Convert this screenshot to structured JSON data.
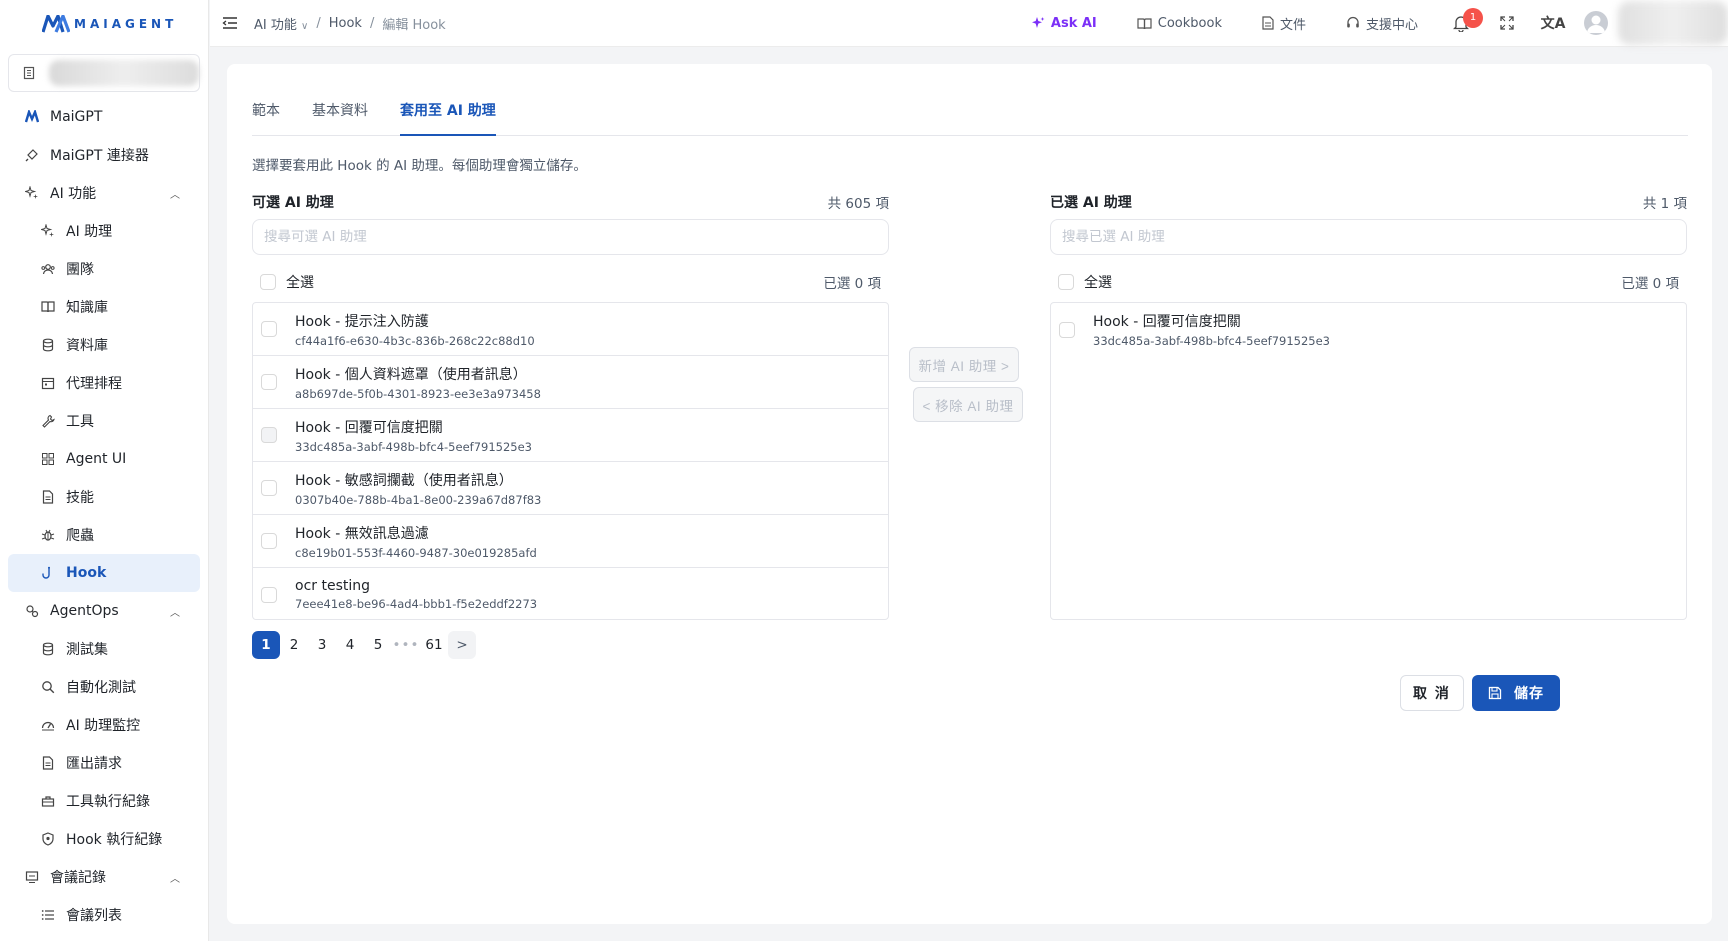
{
  "app": {
    "logo_text": "MAIAGENT"
  },
  "sidebar": {
    "items": [
      {
        "label": "MaiGPT",
        "icon": "maigpt-logo-icon",
        "type": "top"
      },
      {
        "label": "MaiGPT 連接器",
        "icon": "plug-icon",
        "type": "top"
      },
      {
        "label": "AI 功能",
        "icon": "sparkle-icon",
        "type": "group"
      },
      {
        "label": "AI 助理",
        "icon": "sparkle-icon",
        "type": "sub"
      },
      {
        "label": "團隊",
        "icon": "team-icon",
        "type": "sub"
      },
      {
        "label": "知識庫",
        "icon": "book-icon",
        "type": "sub"
      },
      {
        "label": "資料庫",
        "icon": "database-icon",
        "type": "sub"
      },
      {
        "label": "代理排程",
        "icon": "calendar-icon",
        "type": "sub"
      },
      {
        "label": "工具",
        "icon": "wrench-icon",
        "type": "sub"
      },
      {
        "label": "Agent UI",
        "icon": "grid-icon",
        "type": "sub"
      },
      {
        "label": "技能",
        "icon": "file-icon",
        "type": "sub"
      },
      {
        "label": "爬蟲",
        "icon": "bug-icon",
        "type": "sub"
      },
      {
        "label": "Hook",
        "icon": "hook-icon",
        "type": "sub-active"
      },
      {
        "label": "AgentOps",
        "icon": "agentops-icon",
        "type": "group"
      },
      {
        "label": "測試集",
        "icon": "database-icon",
        "type": "sub"
      },
      {
        "label": "自動化測試",
        "icon": "search-icon",
        "type": "sub"
      },
      {
        "label": "AI 助理監控",
        "icon": "monitor-icon",
        "type": "sub"
      },
      {
        "label": "匯出請求",
        "icon": "file-icon",
        "type": "sub"
      },
      {
        "label": "工具執行紀錄",
        "icon": "toolbox-icon",
        "type": "sub"
      },
      {
        "label": "Hook 執行紀錄",
        "icon": "shield-icon",
        "type": "sub"
      },
      {
        "label": "會議記錄",
        "icon": "meeting-icon",
        "type": "group"
      },
      {
        "label": "會議列表",
        "icon": "list-icon",
        "type": "sub"
      }
    ]
  },
  "header": {
    "breadcrumb": [
      "AI 功能",
      "Hook",
      "編輯 Hook"
    ],
    "ask_ai": "Ask AI",
    "cookbook": "Cookbook",
    "docs": "文件",
    "support": "支援中心",
    "notification_count": "1"
  },
  "tabs": [
    {
      "label": "範本",
      "active": false
    },
    {
      "label": "基本資料",
      "active": false
    },
    {
      "label": "套用至 AI 助理",
      "active": true
    }
  ],
  "description": "選擇要套用此 Hook 的 AI 助理。每個助理會獨立儲存。",
  "available": {
    "title": "可選 AI 助理",
    "total": "共 605 項",
    "search_placeholder": "搜尋可選 AI 助理",
    "select_all": "全選",
    "selected_count": "已選 0 項",
    "items": [
      {
        "name": "Hook - 提示注入防護",
        "id": "cf44a1f6-e630-4b3c-836b-268c22c88d10",
        "disabled": false
      },
      {
        "name": "Hook - 個人資料遮罩（使用者訊息）",
        "id": "a8b697de-5f0b-4301-8923-ee3e3a973458",
        "disabled": false
      },
      {
        "name": "Hook - 回覆可信度把關",
        "id": "33dc485a-3abf-498b-bfc4-5eef791525e3",
        "disabled": true
      },
      {
        "name": "Hook - 敏感詞攔截（使用者訊息）",
        "id": "0307b40e-788b-4ba1-8e00-239a67d87f83",
        "disabled": false
      },
      {
        "name": "Hook - 無效訊息過濾",
        "id": "c8e19b01-553f-4460-9487-30e019285afd",
        "disabled": false
      },
      {
        "name": "ocr testing",
        "id": "7eee41e8-be96-4ad4-bbb1-f5e2eddf2273",
        "disabled": false
      }
    ]
  },
  "transfer": {
    "add_label": "新增 AI 助理 >",
    "remove_label": "< 移除 AI 助理"
  },
  "chosen": {
    "title": "已選 AI 助理",
    "total": "共 1 項",
    "search_placeholder": "搜尋已選 AI 助理",
    "select_all": "全選",
    "selected_count": "已選 0 項",
    "items": [
      {
        "name": "Hook - 回覆可信度把關",
        "id": "33dc485a-3abf-498b-bfc4-5eef791525e3"
      }
    ]
  },
  "pagination": {
    "pages": [
      "1",
      "2",
      "3",
      "4",
      "5"
    ],
    "ellipsis": "•••",
    "last": "61",
    "next": ">",
    "current": "1"
  },
  "actions": {
    "cancel": "取 消",
    "save": "儲存"
  },
  "colors": {
    "primary": "#1a56b8",
    "ask_ai": "#7b2ff7",
    "badge": "#f5524a"
  }
}
